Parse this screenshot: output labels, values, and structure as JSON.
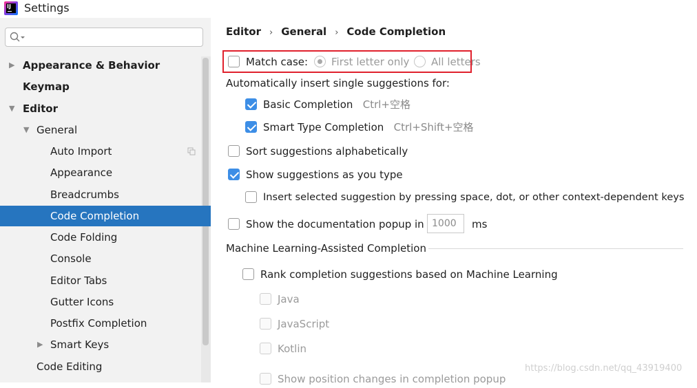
{
  "window": {
    "title": "Settings",
    "logo_text": "IJ"
  },
  "search": {
    "value": "",
    "placeholder": ""
  },
  "tree": [
    {
      "label": "Appearance & Behavior",
      "expandable": true,
      "expanded": false,
      "bold": true
    },
    {
      "label": "Keymap",
      "bold": true
    },
    {
      "label": "Editor",
      "expandable": true,
      "expanded": true,
      "bold": true
    },
    {
      "label": "General",
      "expandable": true,
      "expanded": true
    },
    {
      "label": "Auto Import"
    },
    {
      "label": "Appearance"
    },
    {
      "label": "Breadcrumbs"
    },
    {
      "label": "Code Completion",
      "selected": true
    },
    {
      "label": "Code Folding"
    },
    {
      "label": "Console"
    },
    {
      "label": "Editor Tabs"
    },
    {
      "label": "Gutter Icons"
    },
    {
      "label": "Postfix Completion"
    },
    {
      "label": "Smart Keys",
      "expandable": true,
      "expanded": false
    },
    {
      "label": "Code Editing"
    }
  ],
  "breadcrumb": [
    "Editor",
    "General",
    "Code Completion"
  ],
  "options": {
    "match_case": {
      "label": "Match case:",
      "checked": false
    },
    "first_letter": {
      "label": "First letter only",
      "selected": true
    },
    "all_letters": {
      "label": "All letters",
      "selected": false
    },
    "auto_insert_heading": "Automatically insert single suggestions for:",
    "basic_completion": {
      "label": "Basic Completion",
      "shortcut": "Ctrl+空格",
      "checked": true
    },
    "smart_type": {
      "label": "Smart Type Completion",
      "shortcut": "Ctrl+Shift+空格",
      "checked": true
    },
    "sort_alpha": {
      "label": "Sort suggestions alphabetically",
      "checked": false
    },
    "show_as_type": {
      "label": "Show suggestions as you type",
      "checked": true
    },
    "insert_selected": {
      "label": "Insert selected suggestion by pressing space, dot, or other context-dependent keys",
      "checked": false
    },
    "doc_popup": {
      "label": "Show the documentation popup in",
      "value": "1000",
      "unit": "ms",
      "checked": false
    }
  },
  "ml_section": {
    "title": "Machine Learning-Assisted Completion",
    "rank": {
      "label": "Rank completion suggestions based on Machine Learning",
      "checked": false
    },
    "languages": [
      "Java",
      "JavaScript",
      "Kotlin"
    ],
    "show_position": "Show position changes in completion popup"
  },
  "watermark": "https://blog.csdn.net/qq_43919400",
  "colors": {
    "selection": "#2675bf",
    "checkbox_checked": "#3d8ee6",
    "highlight_border": "#e0202c",
    "sidebar_bg": "#f2f2f2"
  }
}
